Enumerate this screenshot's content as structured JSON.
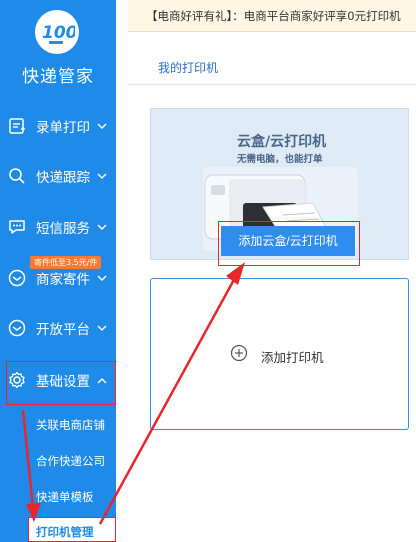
{
  "sidebar": {
    "logo_text": "100",
    "app_title": "快递管家",
    "items": [
      {
        "label": "录单打印",
        "icon": "print-order-icon"
      },
      {
        "label": "快递跟踪",
        "icon": "search-icon"
      },
      {
        "label": "短信服务",
        "icon": "sms-icon"
      },
      {
        "label": "商家寄件",
        "icon": "send-icon"
      },
      {
        "label": "开放平台",
        "icon": "platform-icon"
      },
      {
        "label": "基础设置",
        "icon": "gear-icon"
      }
    ],
    "promo_badge": "寄件低至3.5元/件",
    "sub_items": [
      "关联电商店铺",
      "合作快递公司",
      "快递单模板",
      "打印机管理"
    ]
  },
  "notice": {
    "text": "【电商好评有礼】：电商平台商家好评享0元打印机"
  },
  "breadcrumb": {
    "label": "我的打印机"
  },
  "cloud_card": {
    "title": "云盒/云打印机",
    "subtitle": "无需电脑，也能打单",
    "button_label": "添加云盒/云打印机"
  },
  "add_card": {
    "label": "添加打印机"
  },
  "colors": {
    "sidebar": "#1f8ae8",
    "highlight": "#e8262b",
    "accent": "#2f8df0"
  }
}
